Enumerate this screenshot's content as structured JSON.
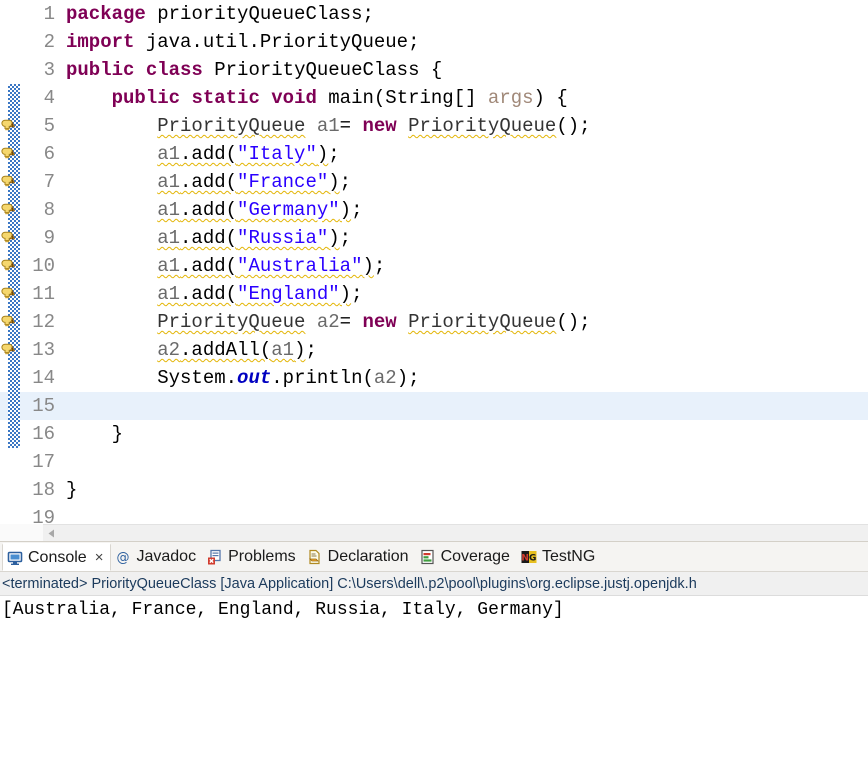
{
  "editor": {
    "name": "java-source-editor",
    "total_visible_lines": 19,
    "current_line": 15,
    "lines": [
      {
        "n": "1",
        "marker": false,
        "band": false,
        "fold": false,
        "warn": false
      },
      {
        "n": "2",
        "marker": false,
        "band": false,
        "fold": false,
        "warn": false
      },
      {
        "n": "3",
        "marker": false,
        "band": false,
        "fold": false,
        "warn": false
      },
      {
        "n": "4",
        "marker": false,
        "band": true,
        "fold": true,
        "warn": false
      },
      {
        "n": "5",
        "marker": true,
        "band": true,
        "fold": false,
        "warn": true
      },
      {
        "n": "6",
        "marker": true,
        "band": true,
        "fold": false,
        "warn": true
      },
      {
        "n": "7",
        "marker": true,
        "band": true,
        "fold": false,
        "warn": true
      },
      {
        "n": "8",
        "marker": true,
        "band": true,
        "fold": false,
        "warn": true
      },
      {
        "n": "9",
        "marker": true,
        "band": true,
        "fold": false,
        "warn": true
      },
      {
        "n": "10",
        "marker": true,
        "band": true,
        "fold": false,
        "warn": true
      },
      {
        "n": "11",
        "marker": true,
        "band": true,
        "fold": false,
        "warn": true
      },
      {
        "n": "12",
        "marker": true,
        "band": true,
        "fold": false,
        "warn": true
      },
      {
        "n": "13",
        "marker": true,
        "band": true,
        "fold": false,
        "warn": true
      },
      {
        "n": "14",
        "marker": false,
        "band": true,
        "fold": false,
        "warn": false
      },
      {
        "n": "15",
        "marker": false,
        "band": true,
        "fold": false,
        "warn": false
      },
      {
        "n": "16",
        "marker": false,
        "band": true,
        "fold": false,
        "warn": false
      },
      {
        "n": "17",
        "marker": false,
        "band": false,
        "fold": false,
        "warn": false
      },
      {
        "n": "18",
        "marker": false,
        "band": false,
        "fold": false,
        "warn": false
      },
      {
        "n": "19",
        "marker": false,
        "band": false,
        "fold": false,
        "warn": false
      }
    ],
    "code_plain": [
      "package priorityQueueClass;",
      "import java.util.PriorityQueue;",
      "public class PriorityQueueClass {",
      "    public static void main(String[] args) {",
      "        PriorityQueue a1= new PriorityQueue();",
      "        a1.add(\"Italy\");",
      "        a1.add(\"France\");",
      "        a1.add(\"Germany\");",
      "        a1.add(\"Russia\");",
      "        a1.add(\"Australia\");",
      "        a1.add(\"England\");",
      "        PriorityQueue a2= new PriorityQueue();",
      "        a2.addAll(a1);",
      "        System.out.println(a2);",
      "",
      "    }",
      "",
      "}",
      ""
    ]
  },
  "scrollbar": {
    "left_arrow_icon": "triangle-left-icon"
  },
  "panel": {
    "tabs": [
      {
        "label": "Console",
        "icon": "console-monitor-icon",
        "active": true,
        "closable": true
      },
      {
        "label": "Javadoc",
        "icon": "javadoc-at-icon",
        "active": false,
        "closable": false
      },
      {
        "label": "Problems",
        "icon": "problems-error-icon",
        "active": false,
        "closable": false
      },
      {
        "label": "Declaration",
        "icon": "declaration-doc-icon",
        "active": false,
        "closable": false
      },
      {
        "label": "Coverage",
        "icon": "coverage-bar-icon",
        "active": false,
        "closable": false
      },
      {
        "label": "TestNG",
        "icon": "testng-icon",
        "active": false,
        "closable": false
      }
    ],
    "close_glyph": "×",
    "status_line": "<terminated> PriorityQueueClass [Java Application] C:\\Users\\dell\\.p2\\pool\\plugins\\org.eclipse.justj.openjdk.h",
    "console_output": "[Australia, France, England, Russia, Italy, Germany]"
  },
  "colors": {
    "keyword": "#7f0055",
    "string": "#2a00ff",
    "static_field": "#0000c0",
    "parameter": "#a08878",
    "local_var": "#6a6a6a",
    "warning_squiggle": "#e3b505",
    "current_line_highlight": "#e8f1fb",
    "change_band": "#3b77c4",
    "status_text": "#1b3a5c"
  }
}
